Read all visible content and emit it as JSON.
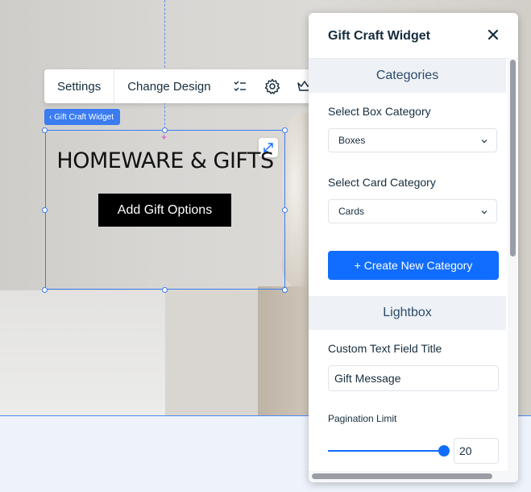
{
  "toolbar": {
    "settings_label": "Settings",
    "change_design_label": "Change Design",
    "icons": [
      "checklist-icon",
      "gear-icon",
      "crown-icon"
    ]
  },
  "selection": {
    "tag_label": "‹ Gift Craft Widget"
  },
  "widget": {
    "title": "HOMEWARE & GIFTS",
    "button_label": "Add Gift Options"
  },
  "panel": {
    "title": "Gift Craft Widget",
    "categories": {
      "heading": "Categories",
      "box_label": "Select Box Category",
      "box_value": "Boxes",
      "card_label": "Select Card Category",
      "card_value": "Cards",
      "create_button": "+ Create New Category"
    },
    "lightbox": {
      "heading": "Lightbox",
      "custom_text_label": "Custom Text Field Title",
      "custom_text_value": "Gift Message",
      "pagination_label": "Pagination Limit",
      "pagination_value": "20"
    }
  },
  "colors": {
    "accent": "#116dff",
    "selection": "#3b7cf0",
    "section_bg": "#eef1f5"
  }
}
